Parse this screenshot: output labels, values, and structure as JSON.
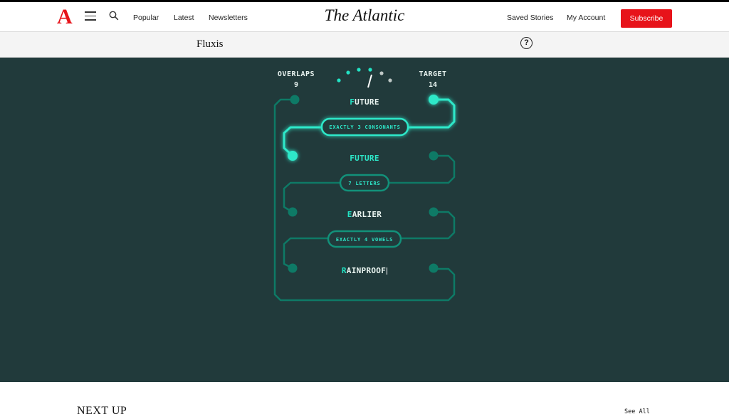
{
  "header": {
    "logo_text": "A",
    "nav": [
      "Popular",
      "Latest",
      "Newsletters"
    ],
    "brand": "The Atlantic",
    "saved_stories": "Saved Stories",
    "my_account": "My Account",
    "subscribe": "Subscribe"
  },
  "game_bar": {
    "title": "Fluxis",
    "help": "?"
  },
  "game": {
    "overlaps_label": "OVERLAPS",
    "overlaps_value": "9",
    "target_label": "TARGET",
    "target_value": "14",
    "progress_fraction": 0.64,
    "words": [
      {
        "first": "F",
        "rest": "UTURE",
        "state": "normal"
      },
      {
        "first": "",
        "rest": "FUTURE",
        "state": "active"
      },
      {
        "first": "E",
        "rest": "ARLIER",
        "state": "normal"
      },
      {
        "first": "R",
        "rest": "AINPROOF",
        "state": "editing"
      }
    ],
    "clues": [
      "EXACTLY 3 CONSONANTS",
      "7 LETTERS",
      "EXACTLY 4 VOWELS"
    ],
    "colors": {
      "background": "#213a3b",
      "accent": "#22e3c4",
      "dim": "#0e7a66"
    }
  },
  "next_up": {
    "heading": "NEXT UP",
    "see_all": "See All"
  }
}
